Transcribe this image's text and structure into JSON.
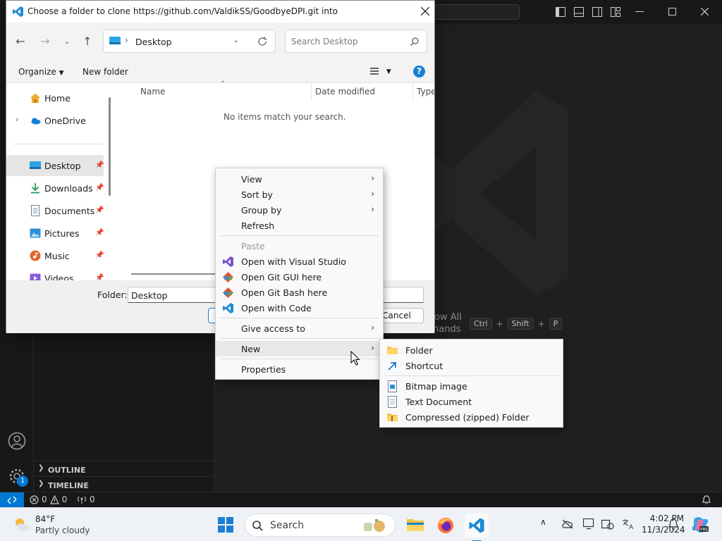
{
  "dialog": {
    "title": "Choose a folder to clone https://github.com/ValdikSS/GoodbyeDPI.git into",
    "address": "Desktop",
    "search_placeholder": "Search Desktop",
    "organize_label": "Organize",
    "new_folder_label": "New folder",
    "nav_items": [
      {
        "label": "Home",
        "icon": "home-icon",
        "pinned": false
      },
      {
        "label": "OneDrive",
        "icon": "onedrive-icon",
        "pinned": false
      },
      {
        "label": "Desktop",
        "icon": "desktop-icon",
        "pinned": true,
        "selected": true
      },
      {
        "label": "Downloads",
        "icon": "downloads-icon",
        "pinned": true
      },
      {
        "label": "Documents",
        "icon": "documents-icon",
        "pinned": true
      },
      {
        "label": "Pictures",
        "icon": "pictures-icon",
        "pinned": true
      },
      {
        "label": "Music",
        "icon": "music-icon",
        "pinned": true
      },
      {
        "label": "Videos",
        "icon": "videos-icon",
        "pinned": true
      }
    ],
    "columns": [
      "Name",
      "Date modified",
      "Type"
    ],
    "empty_message": "No items match your search.",
    "folder_label": "Folder:",
    "folder_value": "Desktop",
    "cancel_label": "Cancel"
  },
  "context_menu": {
    "items": [
      {
        "label": "View",
        "submenu": true
      },
      {
        "label": "Sort by",
        "submenu": true
      },
      {
        "label": "Group by",
        "submenu": true
      },
      {
        "label": "Refresh"
      },
      {
        "label": "Paste",
        "disabled": true
      },
      {
        "label": "Open with Visual Studio",
        "icon": "visual-studio-icon"
      },
      {
        "label": "Open Git GUI here",
        "icon": "git-gui-icon"
      },
      {
        "label": "Open Git Bash here",
        "icon": "git-bash-icon"
      },
      {
        "label": "Open with Code",
        "icon": "vscode-icon"
      },
      {
        "label": "Give access to",
        "submenu": true
      },
      {
        "label": "New",
        "submenu": true,
        "highlighted": true
      },
      {
        "label": "Properties"
      }
    ]
  },
  "new_submenu": {
    "items": [
      {
        "label": "Folder",
        "icon": "folder-icon"
      },
      {
        "label": "Shortcut",
        "icon": "shortcut-icon"
      },
      {
        "label": "Bitmap image",
        "icon": "bitmap-icon"
      },
      {
        "label": "Text Document",
        "icon": "text-document-icon"
      },
      {
        "label": "Compressed (zipped) Folder",
        "icon": "zip-folder-icon"
      }
    ]
  },
  "vscode": {
    "show_all_partial_1": "ow All",
    "show_all_partial_2": "nands",
    "keys": [
      "Ctrl",
      "+",
      "Shift",
      "+",
      "P"
    ],
    "outline_label": "OUTLINE",
    "timeline_label": "TIMELINE",
    "errors_count": "0",
    "warnings_count": "0",
    "ports_count": "0",
    "settings_badge": "1",
    "accent_color": "#0078d4"
  },
  "taskbar": {
    "weather_temp": "84°F",
    "weather_desc": "Partly cloudy",
    "search_label": "Search",
    "time": "4:02 PM",
    "date": "11/3/2024"
  }
}
